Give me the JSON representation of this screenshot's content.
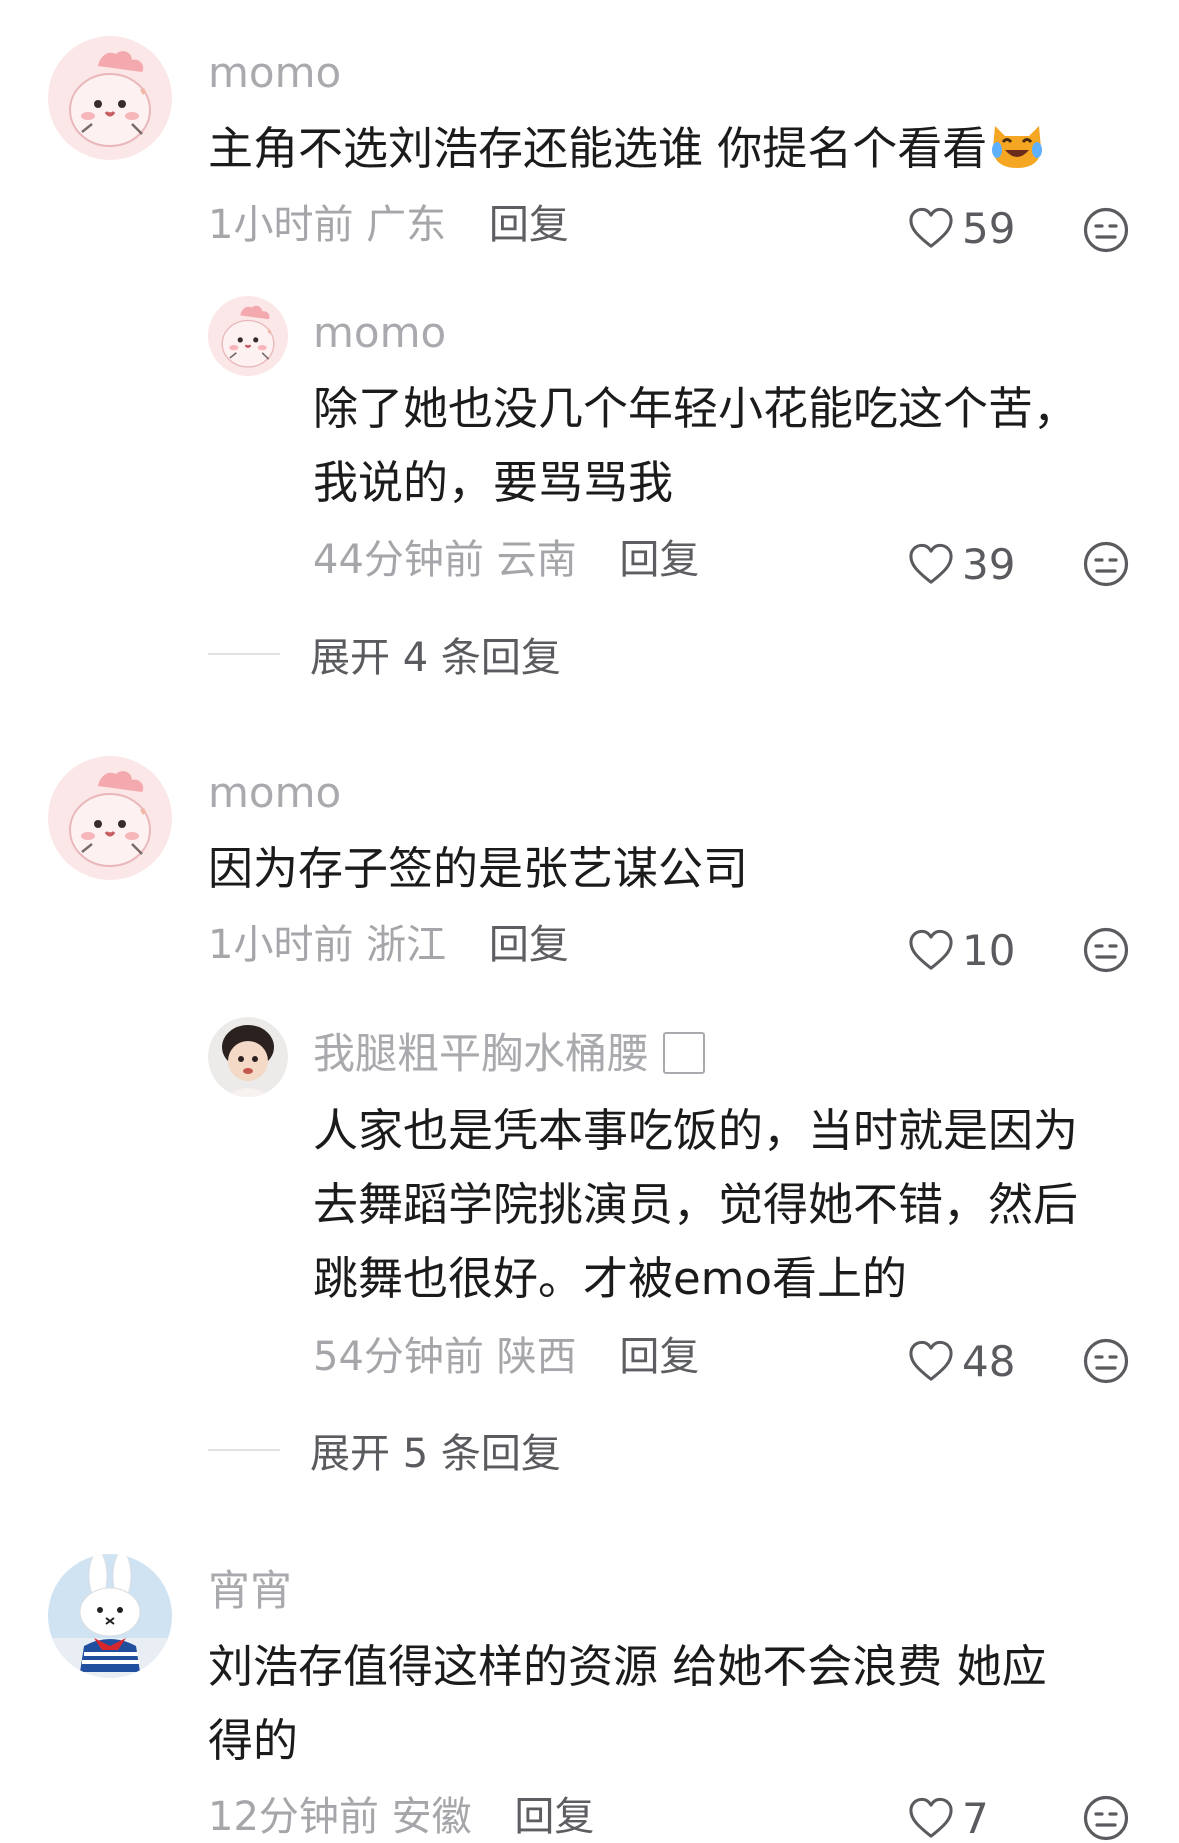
{
  "comments": [
    {
      "user": "momo",
      "text": "主角不选刘浩存还能选谁 你提名个看看",
      "emoji": "crying-laughing-cat-emoji",
      "time": "1小时前",
      "location": "广东",
      "reply_label": "回复",
      "likes": "59",
      "avatar": "pink-blob-avatar",
      "replies": [
        {
          "user": "momo",
          "text_lines": [
            "除了她也没几个年轻小花能吃这个苦，",
            "我说的，要骂骂我"
          ],
          "time": "44分钟前",
          "location": "云南",
          "reply_label": "回复",
          "likes": "39",
          "avatar": "pink-blob-avatar"
        }
      ],
      "expand_label": "展开 4 条回复"
    },
    {
      "user": "momo",
      "text": "因为存子签的是张艺谋公司",
      "time": "1小时前",
      "location": "浙江",
      "reply_label": "回复",
      "likes": "10",
      "avatar": "pink-blob-avatar",
      "replies": [
        {
          "user": "我腿粗平胸水桶腰",
          "text_lines": [
            "人家也是凭本事吃饭的，当时就是因为",
            "去舞蹈学院挑演员，觉得她不错，然后",
            "跳舞也很好。才被emo看上的"
          ],
          "time": "54分钟前",
          "location": "陕西",
          "reply_label": "回复",
          "likes": "48",
          "avatar": "child-photo-avatar"
        }
      ],
      "expand_label": "展开 5 条回复"
    },
    {
      "user": "宵宵",
      "text_lines": [
        "刘浩存值得这样的资源 给她不会浪费 她应",
        "得的"
      ],
      "time": "12分钟前",
      "location": "安徽",
      "reply_label": "回复",
      "likes": "7",
      "avatar": "white-rabbit-avatar"
    }
  ],
  "colors": {
    "username": "#a9aaad",
    "body_text": "#1b1b1b",
    "meta": "#a5a6a9",
    "avatar_pink": "#fbe4e6"
  }
}
